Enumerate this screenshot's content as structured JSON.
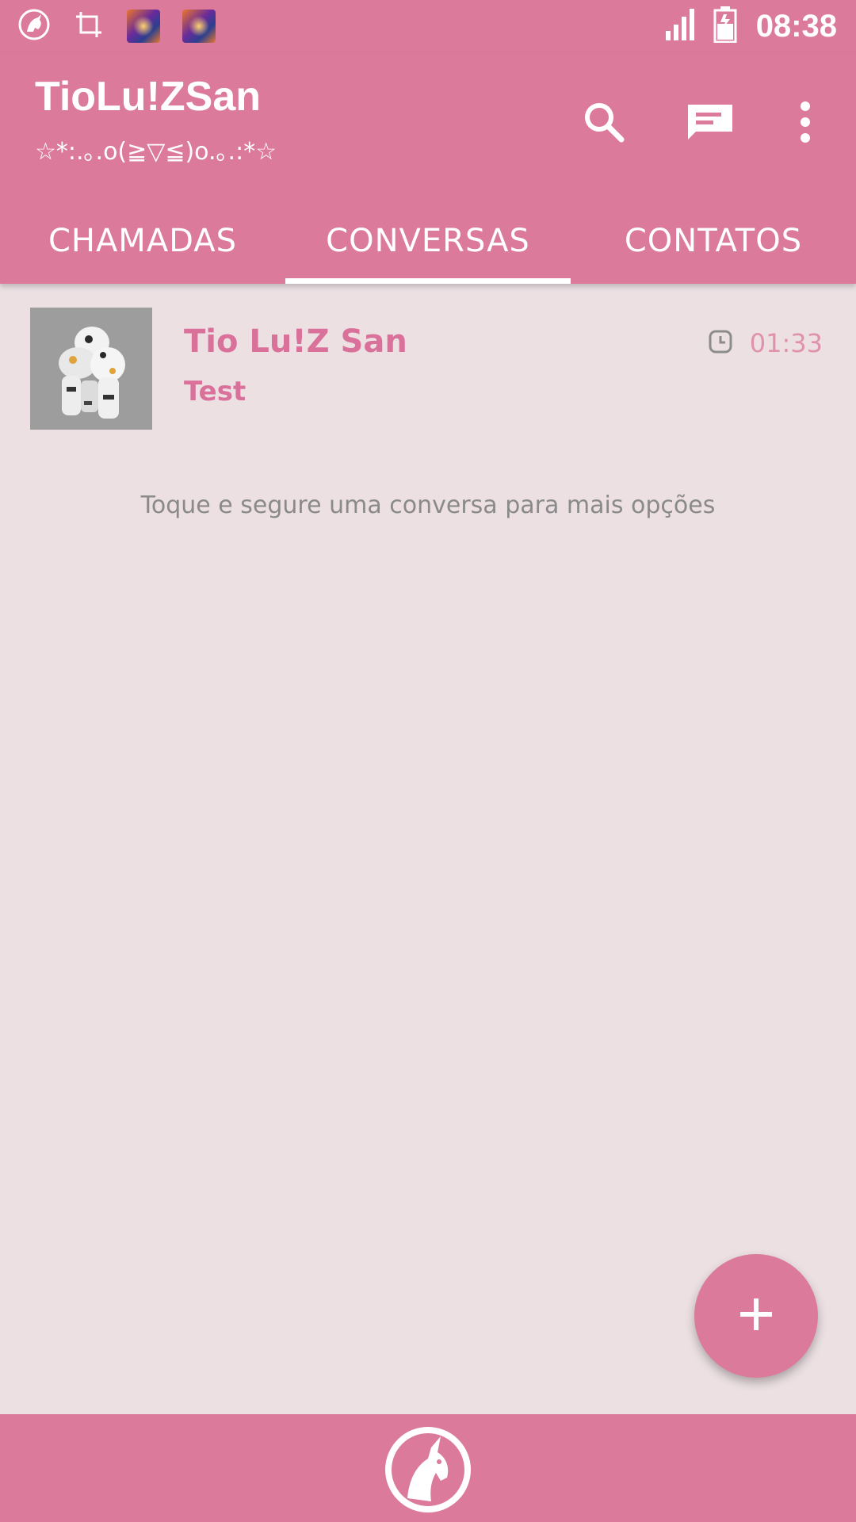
{
  "status_bar": {
    "time": "08:38",
    "icons": [
      "unicorn-icon",
      "crop-icon",
      "app-thumbnail",
      "app-thumbnail",
      "signal-icon",
      "battery-icon"
    ]
  },
  "app_bar": {
    "title": "TioLu!ZSan",
    "subtitle": "☆*:.｡.o(≧▽≦)o.｡.:*☆",
    "actions": [
      "search-icon",
      "new-message-icon",
      "more-vert-icon"
    ]
  },
  "tabs": [
    {
      "label": "CHAMADAS",
      "active": false
    },
    {
      "label": "CONVERSAS",
      "active": true
    },
    {
      "label": "CONTATOS",
      "active": false
    }
  ],
  "conversations": [
    {
      "name": "Tio Lu!Z San",
      "message": "Test",
      "time": "01:33",
      "time_icon": "clock-icon"
    }
  ],
  "hint": "Toque e segure uma conversa para mais opções",
  "fab": {
    "icon": "plus-icon"
  },
  "bottom_bar": {
    "icon": "unicorn-logo-icon"
  },
  "colors": {
    "primary": "#dc7a9b",
    "background": "#ece0e3",
    "accent_text": "#d9719a",
    "hint_text": "#8a8a8a"
  }
}
